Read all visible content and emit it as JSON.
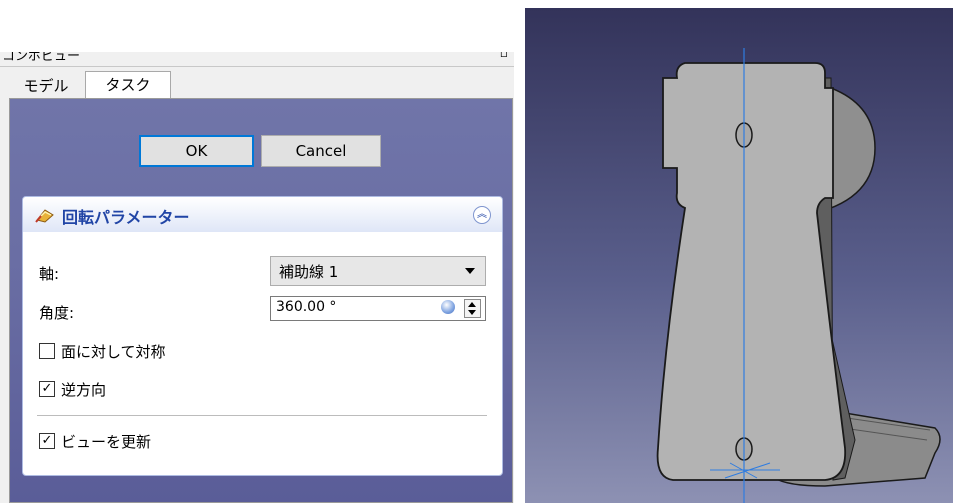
{
  "panel": {
    "title": "コンボビュー",
    "close_glyph": "▫"
  },
  "tabs": [
    {
      "label": "モデル",
      "active": false
    },
    {
      "label": "タスク",
      "active": true
    }
  ],
  "dialog": {
    "ok_label": "OK",
    "cancel_label": "Cancel"
  },
  "revolution": {
    "title": "回転パラメーター",
    "collapse_icon": "chevron-up-icon",
    "axis_label": "軸:",
    "axis_value": "補助線 1",
    "angle_label": "角度:",
    "angle_value": "360.00 °",
    "symmetric": {
      "label": "面に対して対称",
      "checked": false
    },
    "reversed": {
      "label": "逆方向",
      "checked": true
    },
    "update_view": {
      "label": "ビューを更新",
      "checked": true
    }
  },
  "colors": {
    "accent": "#0078d7",
    "header_text": "#2145a6",
    "viewport_top": "#33335a",
    "viewport_bottom": "#8d91b3",
    "axis_line": "#2f7ce0"
  }
}
